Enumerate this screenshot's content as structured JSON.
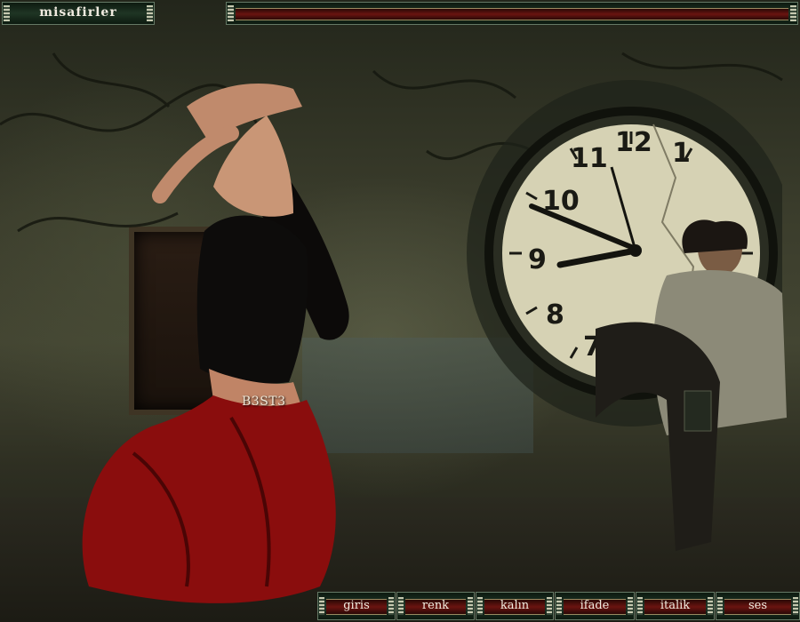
{
  "header": {
    "title": "misafirler"
  },
  "scene": {
    "watermark": "B3ST3",
    "clock_numbers": [
      "12",
      "1",
      "11",
      "10",
      "9",
      "8",
      "7"
    ]
  },
  "toolbar": {
    "buttons": [
      {
        "label": "giris"
      },
      {
        "label": "renk"
      },
      {
        "label": "kalın"
      },
      {
        "label": "ifade"
      },
      {
        "label": "italik"
      },
      {
        "label": "ses"
      }
    ]
  },
  "colors": {
    "bar_dark": "#0d1a10",
    "bar_accent": "#6a1410",
    "dress_red": "#8a0d0d"
  }
}
